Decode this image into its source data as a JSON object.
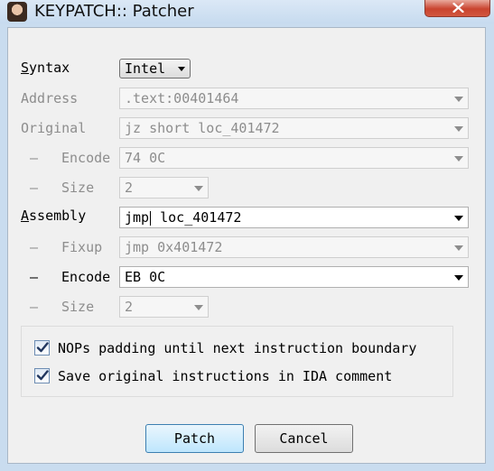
{
  "window": {
    "title": "KEYPATCH:: Patcher",
    "close_icon": "close-icon"
  },
  "syntax": {
    "label": "Syntax",
    "label_underline": "S",
    "label_rest": "yntax",
    "value": "Intel"
  },
  "address": {
    "label": "Address",
    "value": ".text:00401464"
  },
  "original": {
    "label": "Original",
    "value": "jz short loc_401472"
  },
  "original_encode": {
    "dash": "–",
    "label": "Encode",
    "value": "74 0C"
  },
  "original_size": {
    "dash": "–",
    "label": "Size",
    "value": "2"
  },
  "assembly": {
    "label": "Assembly",
    "label_underline": "A",
    "label_rest": "ssembly",
    "value_before_caret": "jmp",
    "value_after_caret": " loc_401472"
  },
  "fixup": {
    "dash": "–",
    "label": "Fixup",
    "value": "jmp 0x401472"
  },
  "assembly_encode": {
    "dash": "–",
    "label": "Encode",
    "value": "EB 0C"
  },
  "assembly_size": {
    "dash": "–",
    "label": "Size",
    "value": "2"
  },
  "options": [
    {
      "label": "NOPs padding until next instruction boundary",
      "checked": true
    },
    {
      "label": "Save original instructions in IDA comment",
      "checked": true
    }
  ],
  "buttons": {
    "patch": "Patch",
    "cancel": "Cancel"
  },
  "colors": {
    "titlebar": "#c9dcef",
    "close": "#c9442f",
    "disabled_text": "#8d8d8d",
    "default_button_border": "#3c7fb1"
  }
}
